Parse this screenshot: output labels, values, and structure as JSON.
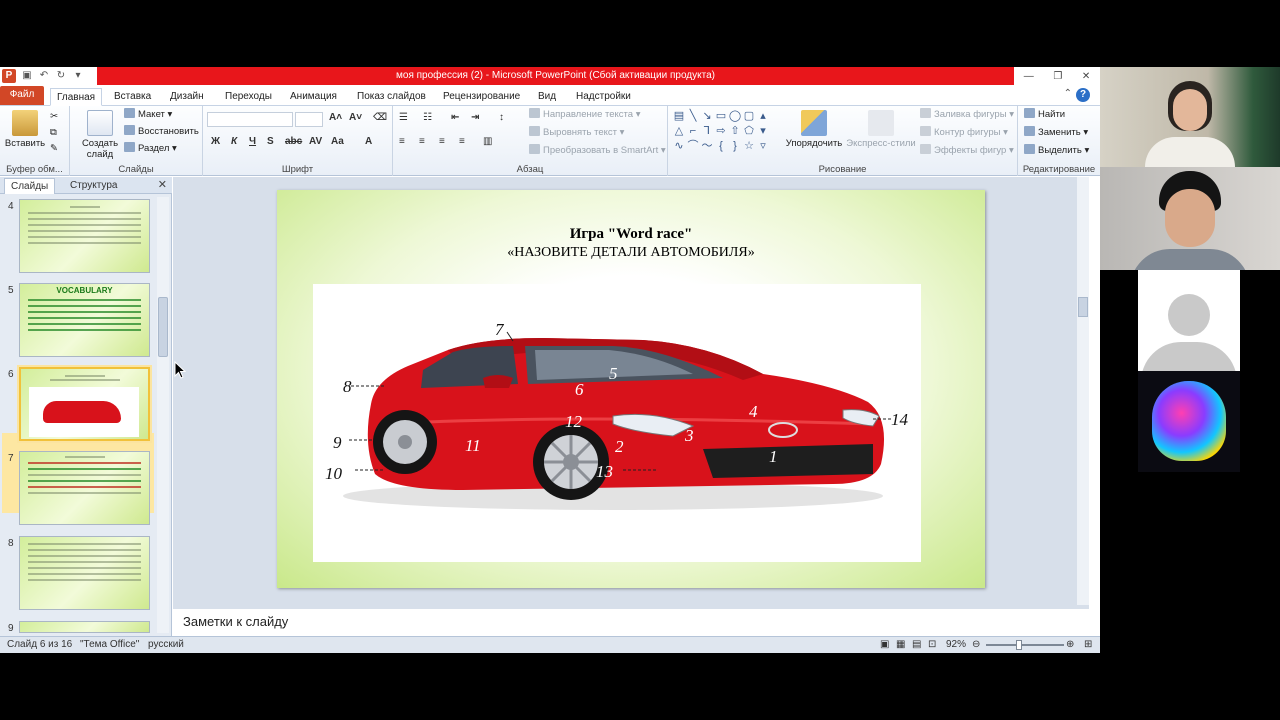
{
  "window": {
    "title": "моя профессия (2)  -  Microsoft PowerPoint (Сбой активации продукта)"
  },
  "tabs": [
    {
      "label": "Файл"
    },
    {
      "label": "Главная"
    },
    {
      "label": "Вставка"
    },
    {
      "label": "Дизайн"
    },
    {
      "label": "Переходы"
    },
    {
      "label": "Анимация"
    },
    {
      "label": "Показ слайдов"
    },
    {
      "label": "Рецензирование"
    },
    {
      "label": "Вид"
    },
    {
      "label": "Надстройки"
    }
  ],
  "ribbon": {
    "clipboard": {
      "label": "Буфер обм...",
      "paste": "Вставить"
    },
    "slides": {
      "label": "Слайды",
      "create": "Создать слайд",
      "layout": "Макет",
      "reset": "Восстановить",
      "section": "Раздел"
    },
    "font": {
      "label": "Шрифт"
    },
    "paragraph": {
      "label": "Абзац",
      "text_direction": "Направление текста",
      "align_text": "Выровнять текст",
      "smartart": "Преобразовать в SmartArt"
    },
    "drawing": {
      "label": "Рисование",
      "arrange": "Упорядочить",
      "quick_styles": "Экспресс-стили",
      "fill": "Заливка фигуры",
      "outline": "Контур фигуры",
      "effects": "Эффекты фигур"
    },
    "editing": {
      "label": "Редактирование",
      "find": "Найти",
      "replace": "Заменить",
      "select": "Выделить"
    }
  },
  "left_pane": {
    "tabs": [
      "Слайды",
      "Структура"
    ],
    "slide_numbers": [
      "4",
      "5",
      "6",
      "7",
      "8",
      "9"
    ],
    "slide5_title": "VOCABULARY"
  },
  "slide": {
    "title": "Игра \"Word race\"",
    "subtitle": "«НАЗОВИТЕ ДЕТАЛИ АВТОМОБИЛЯ»",
    "part_labels": [
      "1",
      "2",
      "3",
      "4",
      "5",
      "6",
      "7",
      "8",
      "9",
      "10",
      "11",
      "12",
      "13",
      "14"
    ]
  },
  "notes": {
    "placeholder": "Заметки к слайду"
  },
  "status": {
    "slide": "Слайд 6 из 16",
    "theme": "\"Тема Office\"",
    "language": "русский",
    "zoom": "92%"
  },
  "colors": {
    "title_bar_red": "#e8161b",
    "file_tab": "#d24726",
    "car_red": "#d8121b"
  }
}
